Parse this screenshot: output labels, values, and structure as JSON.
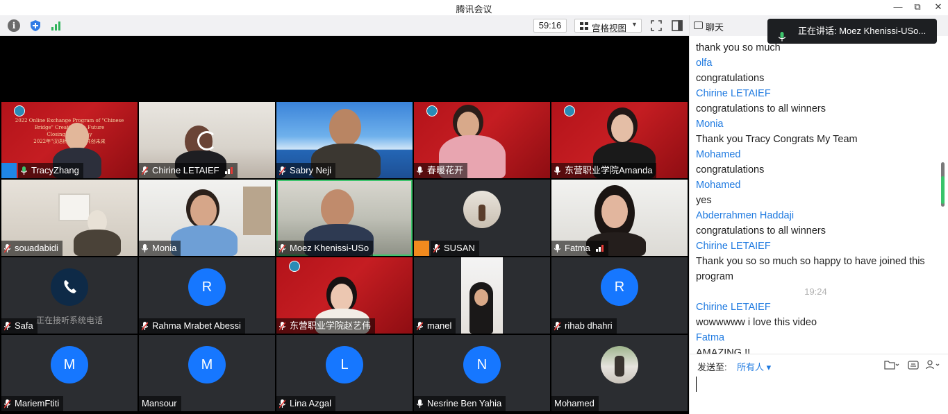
{
  "window": {
    "title": "腾讯会议",
    "controls": {
      "minimize": "—",
      "maximize": "⧉",
      "close": "✕"
    }
  },
  "toolbar": {
    "timer": "59:16",
    "view_label": "宫格视图",
    "view_caret": "▼",
    "icons": [
      "info-icon",
      "shield-icon",
      "signal-icon",
      "fullscreen-icon",
      "side-panel-icon"
    ]
  },
  "banner": {
    "line1": "2022 Online Exchange Program of \"Chinese",
    "line2": "Bridge\" Creating the Future",
    "line3": "Closing Ceremony",
    "line4": "2022年\"汉语桥\"线上团 共创未来"
  },
  "participants": [
    {
      "name": "TracyZhang",
      "mic": "on"
    },
    {
      "name": "Chirine LETAIEF",
      "mic": "muted"
    },
    {
      "name": "Sabry Neji",
      "mic": "muted"
    },
    {
      "name": "春暖花开",
      "mic": "on"
    },
    {
      "name": "东营职业学院Amanda",
      "mic": "on"
    },
    {
      "name": "souadabidi",
      "mic": "muted"
    },
    {
      "name": "Monia",
      "mic": "on"
    },
    {
      "name": "Moez Khenissi-USo",
      "mic": "muted"
    },
    {
      "name": "SUSAN",
      "mic": "muted"
    },
    {
      "name": "Fatma",
      "mic": "on"
    },
    {
      "name": "Safa",
      "mic": "muted",
      "status": "正在接听系统电话"
    },
    {
      "name": "Rahma Mrabet Abessi",
      "mic": "muted",
      "initial": "R"
    },
    {
      "name": "东营职业学院赵艺伟",
      "mic": "muted"
    },
    {
      "name": "manel",
      "mic": "muted"
    },
    {
      "name": "rihab dhahri",
      "mic": "muted",
      "initial": "R"
    },
    {
      "name": "MariemFtiti",
      "mic": "muted",
      "initial": "M"
    },
    {
      "name": "Mansour",
      "mic": "none",
      "initial": "M"
    },
    {
      "name": "Lina Azgal",
      "mic": "muted",
      "initial": "L"
    },
    {
      "name": "Nesrine Ben Yahia",
      "mic": "on",
      "initial": "N"
    },
    {
      "name": "Mohamed",
      "mic": "none"
    }
  ],
  "chat": {
    "title": "聊天",
    "speaking_banner": "正在讲话: Moez Khenissi-USo...",
    "messages": [
      {
        "text": "thank you so much"
      },
      {
        "sender": "olfa",
        "text": "congratulations"
      },
      {
        "sender": "Chirine LETAIEF",
        "text": "congratulations to all winners"
      },
      {
        "sender": "Monia",
        "text": "Thank you Tracy Congrats My Team"
      },
      {
        "sender": "Mohamed",
        "text": "congratulations"
      },
      {
        "sender": "Mohamed",
        "text": "yes"
      },
      {
        "sender": "Abderrahmen Haddaji",
        "text": "congratulations to all winners"
      },
      {
        "sender": "Chirine LETAIEF",
        "text": "Thank you so so much so happy to have joined this program"
      }
    ],
    "time": "19:24",
    "messages_after": [
      {
        "sender": "Chirine LETAIEF",
        "text": "wowwwww i love this video"
      },
      {
        "sender": "Fatma",
        "text": "AMAZING !!"
      }
    ],
    "send_label": "发送至:",
    "send_to": "所有人 ▾"
  },
  "colors": {
    "accent": "#1f7ae0",
    "avatar": "#1677ff",
    "talking": "#3ec46d"
  }
}
